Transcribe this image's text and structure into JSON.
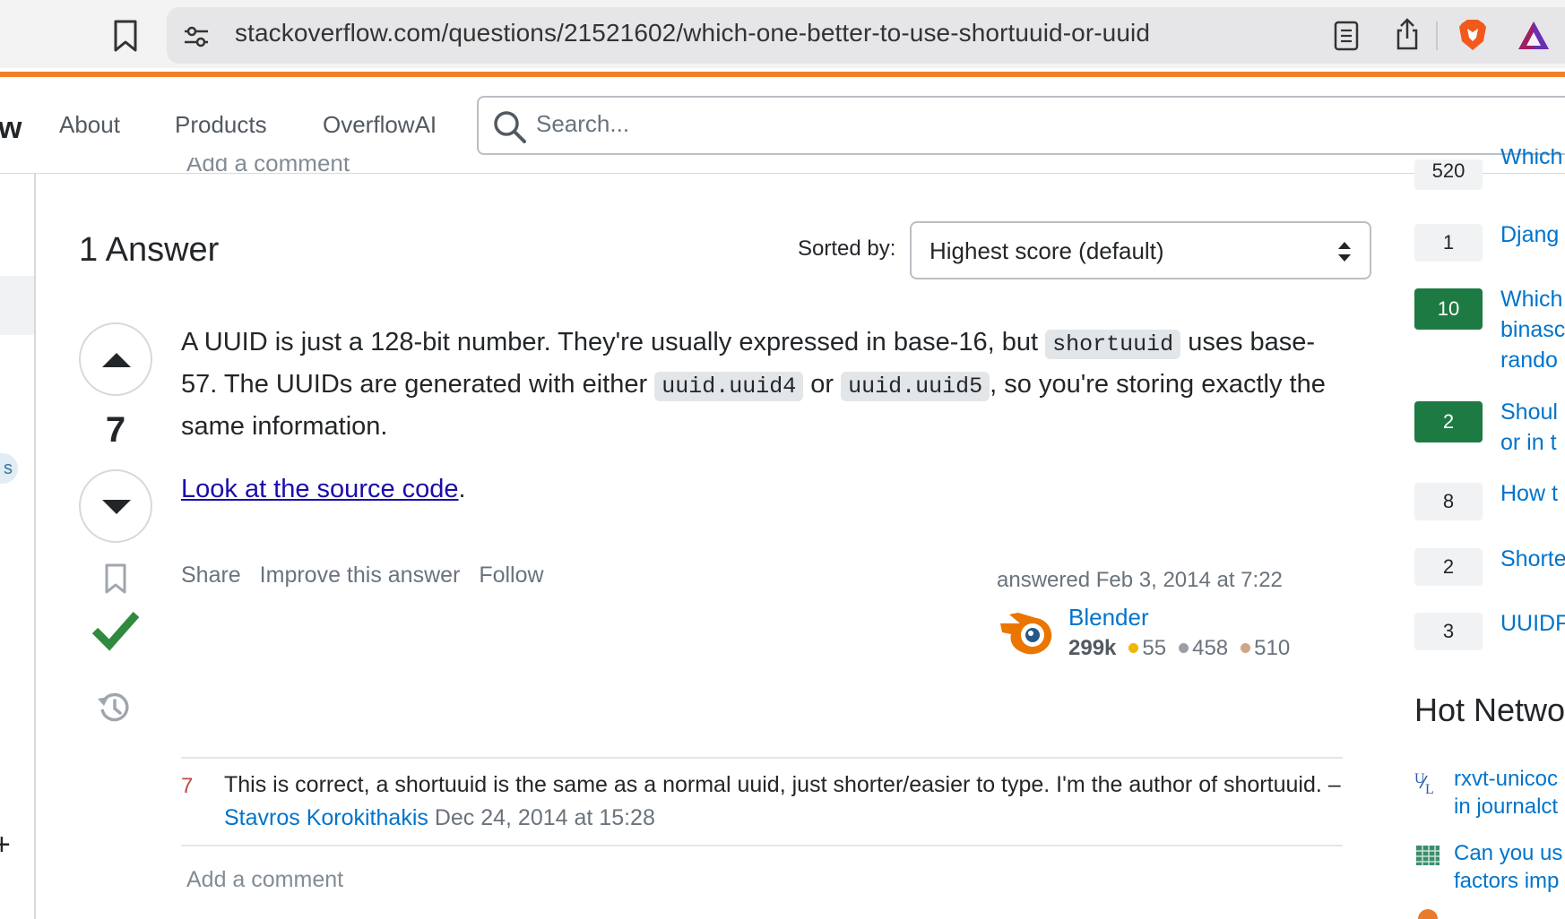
{
  "browser": {
    "url": "stackoverflow.com/questions/21521602/which-one-better-to-use-shortuuid-or-uuid"
  },
  "header": {
    "logo_fragment": "w",
    "nav": [
      "About",
      "Products",
      "OverflowAI"
    ],
    "search_placeholder": "Search..."
  },
  "sidebar_left": {
    "pill_fragment": "s",
    "plus_glyph": "+"
  },
  "top_comment_fragment": "Add a comment",
  "answers": {
    "title": "1 Answer",
    "sorted_label": "Sorted by:",
    "sort_value": "Highest score (default)"
  },
  "answer": {
    "score": "7",
    "body_parts": {
      "p1": "A UUID is just a 128-bit number. They're usually expressed in base-16, but ",
      "code1": "shortuuid",
      "p2": " uses base-57. The UUIDs are generated with either ",
      "code2": "uuid.uuid4",
      "p3": " or ",
      "code3": "uuid.uuid5",
      "p4": ", so you're storing exactly the same information."
    },
    "link_text": "Look at the source code",
    "link_suffix": ".",
    "menu": [
      "Share",
      "Improve this answer",
      "Follow"
    ],
    "answered": "answered Feb 3, 2014 at 7:22",
    "user": {
      "name": "Blender",
      "rep": "299k",
      "gold": "55",
      "silver": "458",
      "bronze": "510"
    }
  },
  "comment": {
    "score": "7",
    "text": "This is correct, a shortuuid is the same as a normal uuid, just shorter/easier to type. I'm the author of shortuuid. – ",
    "user": "Stavros Korokithakis",
    "date": "Dec 24, 2014 at 15:28",
    "add_label": "Add a comment"
  },
  "linked": [
    {
      "score": "520",
      "title": "Which",
      "accepted": false
    },
    {
      "score": "1",
      "title": "Djang",
      "accepted": false
    },
    {
      "score": "10",
      "title": "Which",
      "title2": "binasc",
      "title3": "rando",
      "accepted": true
    },
    {
      "score": "2",
      "title": "Shoul",
      "title2": "or in t",
      "accepted": true
    },
    {
      "score": "8",
      "title": "How t",
      "accepted": false
    },
    {
      "score": "2",
      "title": "Shorte",
      "accepted": false
    },
    {
      "score": "3",
      "title": "UUIDF",
      "accepted": false
    }
  ],
  "hot_network": {
    "title": "Hot Netwo",
    "items": [
      {
        "line1": "rxvt-unicoc",
        "line2": "in journalct"
      },
      {
        "line1": "Can you us",
        "line2": "factors imp"
      }
    ]
  },
  "colors": {
    "accent_orange": "#f48024",
    "link_blue": "#0074cc",
    "accepted_green": "#1e7a43",
    "gold": "#f1b600",
    "silver": "#9a9fa5",
    "bronze": "#d1a684"
  }
}
